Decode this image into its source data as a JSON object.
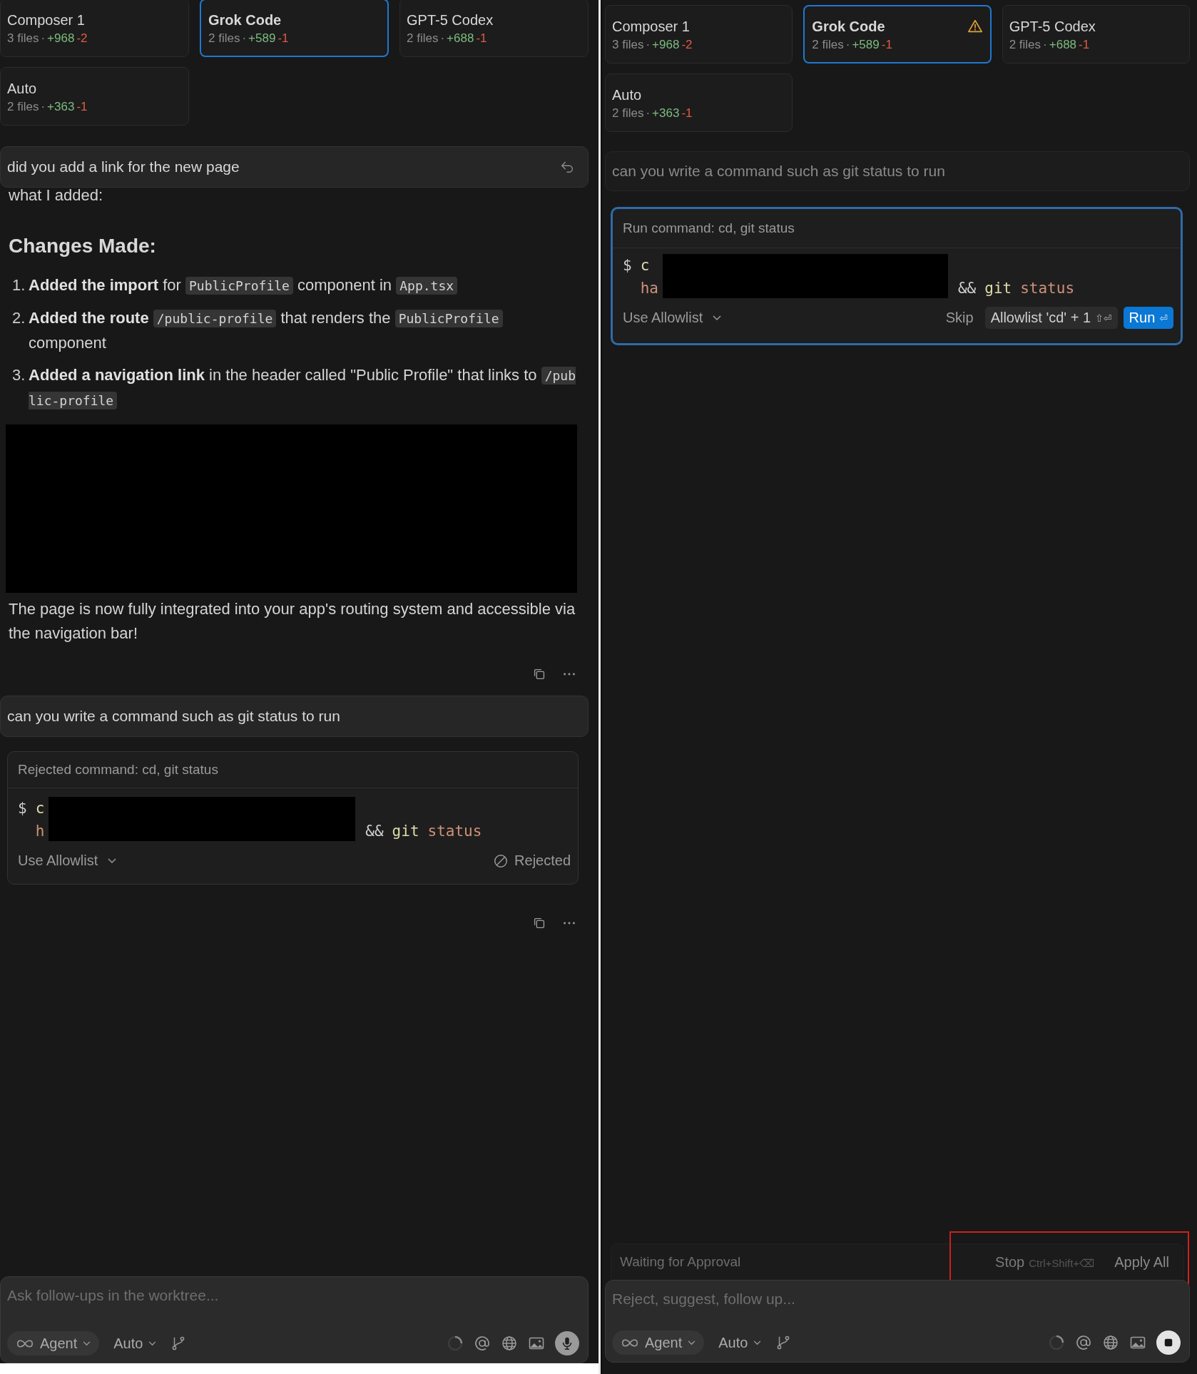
{
  "panes": [
    {
      "model_cards": [
        {
          "name": "Composer 1",
          "files": "3 files",
          "separator": "·",
          "added": "+968",
          "removed": "-2",
          "selected": false,
          "warning": false
        },
        {
          "name": "Grok Code",
          "files": "2 files",
          "separator": "·",
          "added": "+589",
          "removed": "-1",
          "selected": true,
          "warning": false
        },
        {
          "name": "GPT-5 Codex",
          "files": "2 files",
          "separator": "·",
          "added": "+688",
          "removed": "-1",
          "selected": false,
          "warning": false
        },
        {
          "name": "Auto",
          "files": "2 files",
          "separator": "·",
          "added": "+363",
          "removed": "-1",
          "selected": false,
          "warning": false
        }
      ],
      "thread": [
        {
          "kind": "user",
          "text": "did you add a link for the new page",
          "dimmed": false,
          "revert": true
        },
        {
          "kind": "text",
          "text": "what I added:"
        },
        {
          "kind": "heading",
          "text": "Changes Made:"
        },
        {
          "kind": "list",
          "items": [
            {
              "number": "1.",
              "parts": [
                {
                  "kind": "bold",
                  "text": "Added the import"
                },
                {
                  "kind": "text",
                  "text": " for "
                },
                {
                  "kind": "code",
                  "text": "PublicProfile"
                },
                {
                  "kind": "text",
                  "text": " component in "
                },
                {
                  "kind": "code",
                  "text": "App.tsx"
                }
              ]
            },
            {
              "number": "2.",
              "parts": [
                {
                  "kind": "bold",
                  "text": "Added the route "
                },
                {
                  "kind": "code",
                  "text": "/public-profile"
                },
                {
                  "kind": "text",
                  "text": " that renders the "
                },
                {
                  "kind": "code",
                  "text": "PublicProfile"
                },
                {
                  "kind": "text",
                  "text": " component"
                }
              ]
            },
            {
              "number": "3.",
              "parts": [
                {
                  "kind": "bold",
                  "text": "Added a navigation link"
                },
                {
                  "kind": "text",
                  "text": " in the header called \"Public Profile\" that links to "
                },
                {
                  "kind": "code",
                  "text": "/public-profile"
                }
              ]
            }
          ]
        },
        {
          "kind": "redacted"
        },
        {
          "kind": "text",
          "text": "The page is now fully integrated into your app's routing system and accessible via the navigation bar!"
        },
        {
          "kind": "actions"
        },
        {
          "kind": "user",
          "text": "can you write a command such as git status to run",
          "dimmed": false,
          "revert": false
        },
        {
          "kind": "command",
          "rejected": true,
          "title": "Rejected command: cd, git status",
          "prompt": "$",
          "head": [
            [
              {
                "kind": "command",
                "text": "c"
              }
            ],
            [
              {
                "kind": "argument",
                "text": "h"
              }
            ]
          ],
          "tail": [
            {
              "kind": "operator",
              "text": "&&"
            },
            {
              "kind": "command",
              "text": "git"
            },
            {
              "kind": "argument",
              "text": "status"
            }
          ],
          "allowlist": "Use Allowlist",
          "status_label": "Rejected"
        },
        {
          "kind": "actions"
        }
      ],
      "composer": {
        "placeholder": "Ask follow-ups in the worktree...",
        "mode": "Agent",
        "model": "Auto",
        "generating": false
      }
    },
    {
      "model_cards": [
        {
          "name": "Composer 1",
          "files": "3 files",
          "separator": "·",
          "added": "+968",
          "removed": "-2",
          "selected": false,
          "warning": false
        },
        {
          "name": "Grok Code",
          "files": "2 files",
          "separator": "·",
          "added": "+589",
          "removed": "-1",
          "selected": true,
          "warning": true
        },
        {
          "name": "GPT-5 Codex",
          "files": "2 files",
          "separator": "·",
          "added": "+688",
          "removed": "-1",
          "selected": false,
          "warning": false
        },
        {
          "name": "Auto",
          "files": "2 files",
          "separator": "·",
          "added": "+363",
          "removed": "-1",
          "selected": false,
          "warning": false
        }
      ],
      "thread": [
        {
          "kind": "user",
          "text": "can you write a command such as git status to run",
          "dimmed": true,
          "revert": false
        },
        {
          "kind": "command",
          "rejected": false,
          "title": "Run command: cd, git status",
          "prompt": "$",
          "head": [
            [
              {
                "kind": "command",
                "text": "c"
              }
            ],
            [
              {
                "kind": "argument",
                "text": "ha"
              }
            ]
          ],
          "tail": [
            {
              "kind": "operator",
              "text": "&&"
            },
            {
              "kind": "command",
              "text": "git"
            },
            {
              "kind": "argument",
              "text": "status"
            }
          ],
          "allowlist": "Use Allowlist",
          "actions": [
            {
              "kind": "skip",
              "label": "Skip"
            },
            {
              "kind": "allowlist",
              "label": "Allowlist 'cd' + 1",
              "shortcut": "⇧⏎"
            },
            {
              "kind": "run",
              "label": "Run",
              "shortcut": "⏎"
            }
          ]
        }
      ],
      "status_bar": {
        "text": "Waiting for Approval",
        "stop_label": "Stop",
        "stop_shortcut": "Ctrl+Shift+⌫",
        "apply_label": "Apply All",
        "highlighted": true
      },
      "composer": {
        "placeholder": "Reject, suggest, follow up...",
        "mode": "Agent",
        "model": "Auto",
        "generating": true
      }
    }
  ]
}
